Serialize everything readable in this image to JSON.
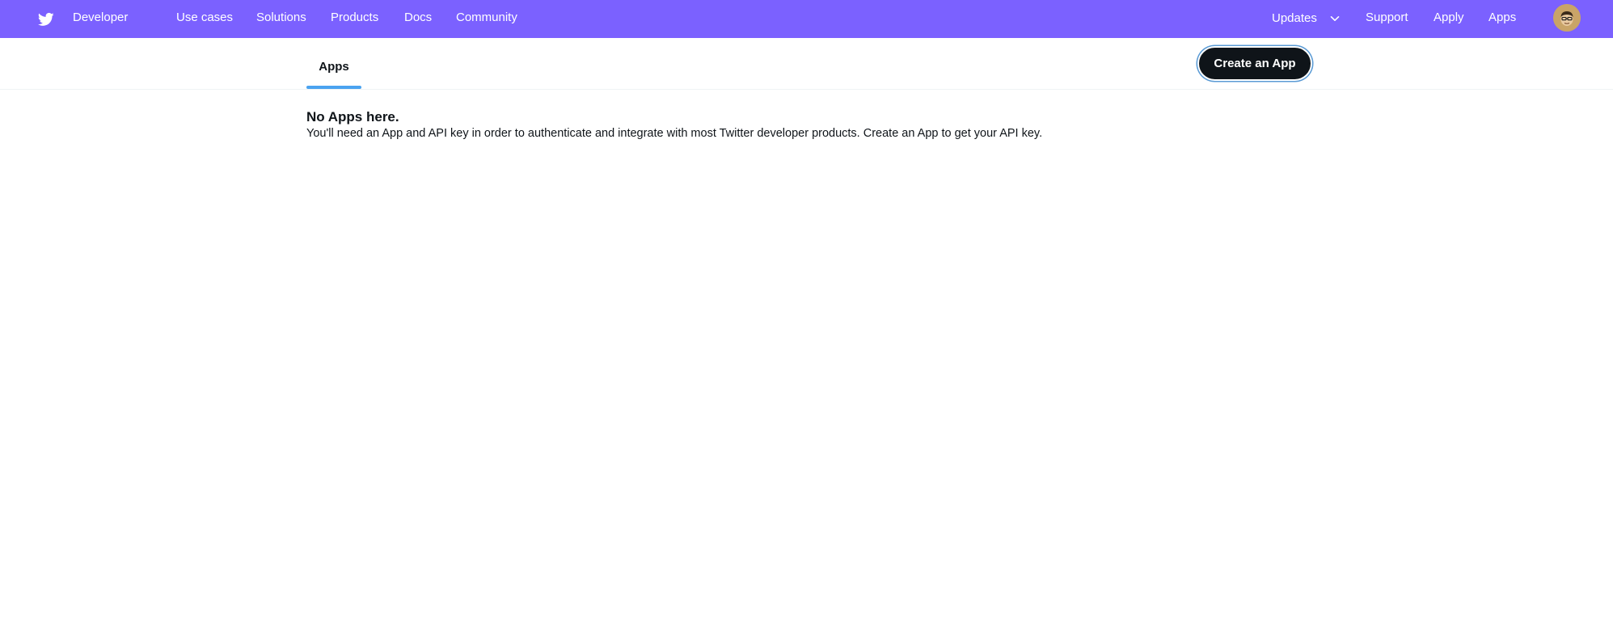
{
  "header": {
    "brand_label": "Developer",
    "nav": [
      {
        "label": "Use cases"
      },
      {
        "label": "Solutions"
      },
      {
        "label": "Products"
      },
      {
        "label": "Docs"
      },
      {
        "label": "Community"
      }
    ],
    "right_nav": {
      "updates_label": "Updates",
      "support_label": "Support",
      "apply_label": "Apply",
      "apps_label": "Apps"
    },
    "colors": {
      "nav_bg": "#7b61ff",
      "nav_text": "#ffffff"
    }
  },
  "tabs": [
    {
      "label": "Apps",
      "active": true
    }
  ],
  "actions": {
    "create_app_label": "Create an App"
  },
  "empty_state": {
    "title": "No Apps here.",
    "description": "You'll need an App and API key in order to authenticate and integrate with most Twitter developer products. Create an App to get your API key."
  },
  "icons": {
    "brand": "twitter-bird-icon",
    "updates_toggle": "chevron-down-icon",
    "user": "avatar"
  },
  "colors": {
    "accent_tab": "#4aa3f0",
    "primary_button": "#0f1419"
  }
}
